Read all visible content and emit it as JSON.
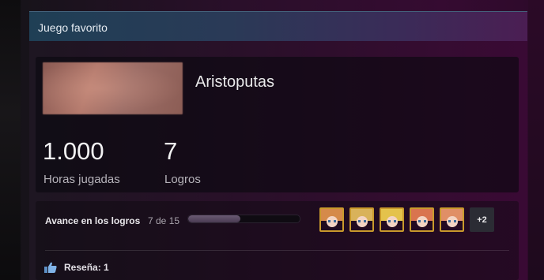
{
  "panel": {
    "title": "Juego favorito"
  },
  "game": {
    "name": "Aristoputas",
    "stats": [
      {
        "value": "1.000",
        "label": "Horas jugadas"
      },
      {
        "value": "7",
        "label": "Logros"
      }
    ]
  },
  "achievements": {
    "label": "Avance en los logros",
    "count_text": "7 de 15",
    "progress_fraction": 0.467,
    "more_label": "+2",
    "icons": [
      "achievement-icon",
      "achievement-icon",
      "achievement-icon",
      "achievement-icon",
      "achievement-icon"
    ]
  },
  "review": {
    "label": "Reseña: 1",
    "icon": "thumbs-up-icon"
  },
  "colors": {
    "accent_gold": "#c99a2c",
    "header_blue": "#1f3f55",
    "bg_magenta": "#350b31"
  }
}
